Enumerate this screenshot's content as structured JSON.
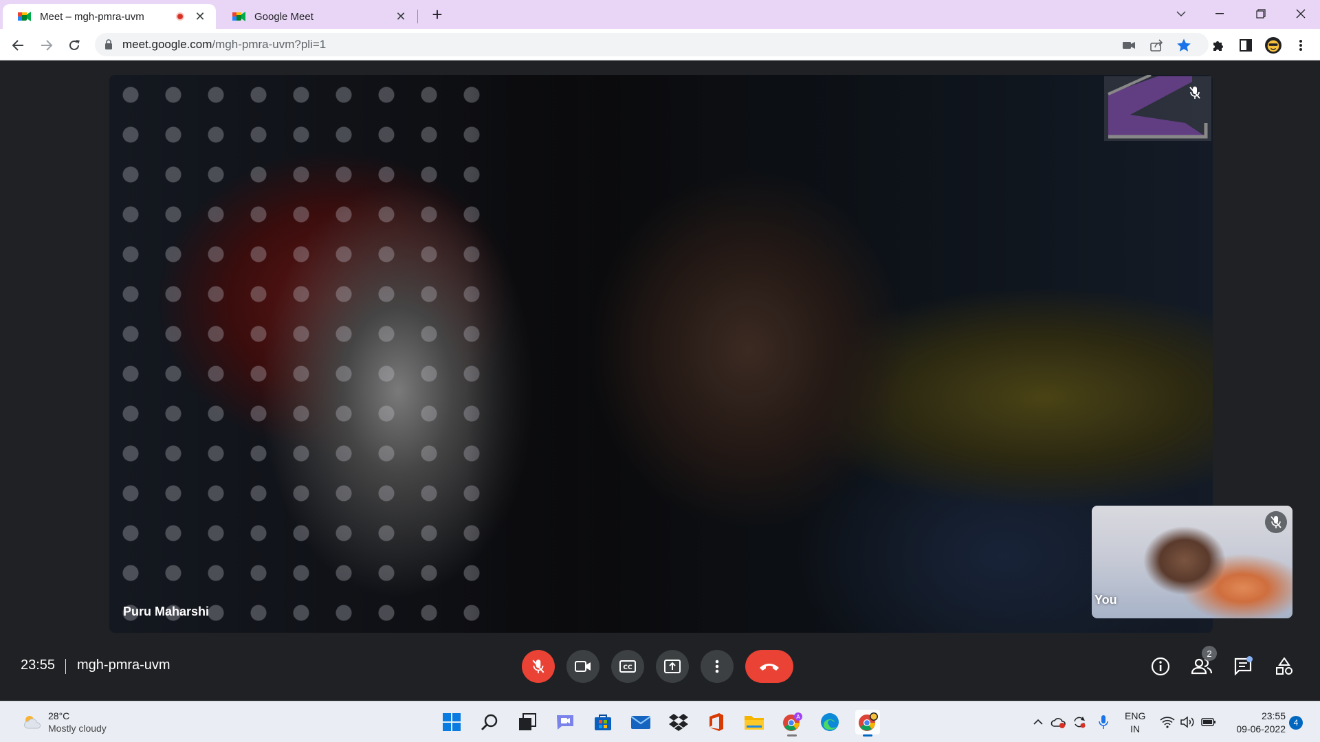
{
  "browser": {
    "tabs": [
      {
        "title": "Meet – mgh-pmra-uvm",
        "recording": true,
        "active": true
      },
      {
        "title": "Google Meet",
        "active": false
      }
    ],
    "new_tab_symbol": "+",
    "close_symbol": "✕",
    "window_controls": [
      "chevron-down-icon",
      "minimize-icon",
      "restore-icon",
      "close-icon"
    ],
    "url_host": "meet.google.com",
    "url_path": "/mgh-pmra-uvm?pli=1",
    "bookmark_color": "#1a73e8"
  },
  "meet": {
    "main_participant": "Puru Maharshi",
    "self_label": "You",
    "time": "23:55",
    "meeting_code": "mgh-pmra-uvm",
    "people_count": "2",
    "controls": [
      "mic-off-icon",
      "camera-icon",
      "captions-icon",
      "present-icon",
      "more-options-icon",
      "hang-up-icon"
    ],
    "right_controls": [
      "info-icon",
      "people-icon",
      "chat-icon",
      "activities-icon"
    ],
    "hangup_color": "#ea4335"
  },
  "taskbar": {
    "weather_temp": "28°C",
    "weather_condition": "Mostly cloudy",
    "apps": [
      "windows-start-icon",
      "search-icon",
      "task-view-icon",
      "teams-chat-icon",
      "store-icon",
      "mail-icon",
      "dropbox-icon",
      "office-icon",
      "file-explorer-icon",
      "chrome-profile-icon",
      "edge-icon",
      "chrome-icon"
    ],
    "lang_line1": "ENG",
    "lang_line2": "IN",
    "clock_time": "23:55",
    "clock_date": "09-06-2022",
    "notification_count": "4"
  }
}
